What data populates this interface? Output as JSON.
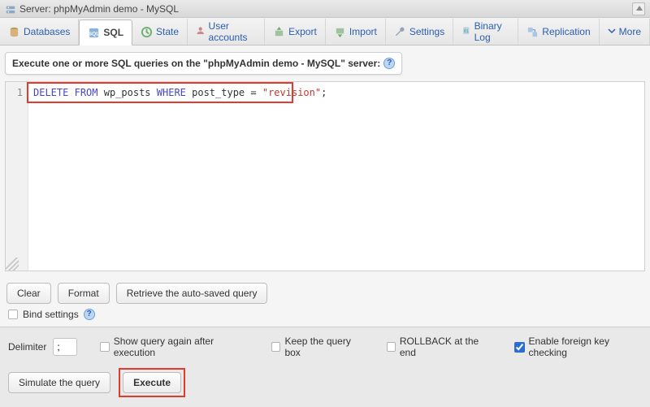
{
  "titlebar": {
    "text": "Server: phpMyAdmin demo - MySQL"
  },
  "tabs": {
    "databases": "Databases",
    "sql": "SQL",
    "state": "State",
    "user_accounts": "User accounts",
    "export": "Export",
    "import": "Import",
    "settings": "Settings",
    "binary_log": "Binary Log",
    "replication": "Replication",
    "more": "More"
  },
  "instruction": {
    "prefix": "Execute one or more SQL queries on the ",
    "quoted": "\"phpMyAdmin demo - MySQL\"",
    "suffix": " server:"
  },
  "editor": {
    "line_number": "1",
    "sql": {
      "kw1": "DELETE",
      "kw2": "FROM",
      "tbl": "wp_posts",
      "kw3": "WHERE",
      "col": "post_type",
      "eq": " = ",
      "str": "\"revision\"",
      "semi": ";"
    }
  },
  "buttons": {
    "clear": "Clear",
    "format": "Format",
    "retrieve": "Retrieve the auto-saved query",
    "simulate": "Simulate the query",
    "execute": "Execute"
  },
  "bind": {
    "label": "Bind settings"
  },
  "footer": {
    "delimiter_label": "Delimiter",
    "delimiter_value": ";",
    "show_again": "Show query again after execution",
    "keep_box": "Keep the query box",
    "rollback": "ROLLBACK at the end",
    "fk_check": "Enable foreign key checking"
  }
}
